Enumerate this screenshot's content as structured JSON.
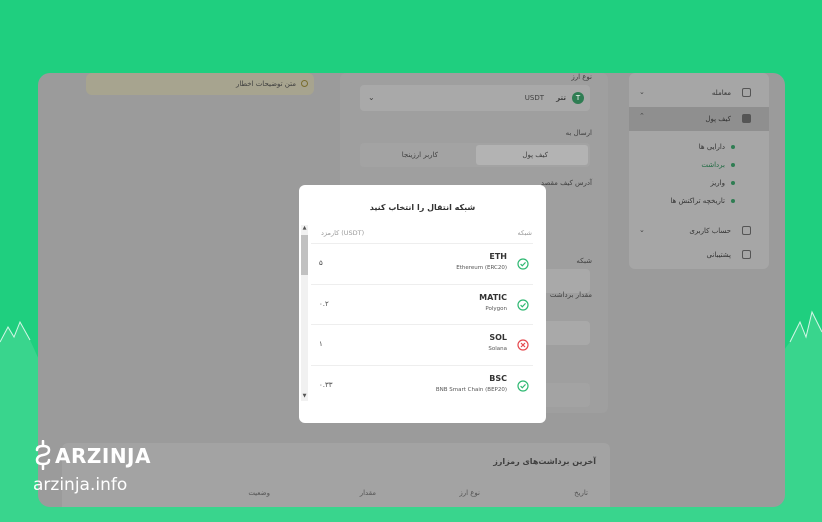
{
  "modal": {
    "title": "شبکه انتقال را انتخاب کنید",
    "col_network": "شبکه",
    "col_fee": "کارمزد (USDT)",
    "networks": [
      {
        "symbol": "ETH",
        "name": "Ethereum (ERC20)",
        "fee": "۵",
        "status": "available",
        "status_color": "#2eb872"
      },
      {
        "symbol": "MATIC",
        "name": "Polygon",
        "fee": "۰.۲",
        "status": "available",
        "status_color": "#2eb872"
      },
      {
        "symbol": "SOL",
        "name": "Solana",
        "fee": "۱",
        "status": "unavailable",
        "status_color": "#e5484d"
      },
      {
        "symbol": "BSC",
        "name": "BNB Smart Chain (BEP20)",
        "fee": "۰.۳۳",
        "status": "available",
        "status_color": "#2eb872"
      }
    ]
  },
  "background": {
    "warning_text": "متن توضیحات اخطار",
    "coin_label": "نوع ارز",
    "coin_name": "تتر",
    "coin_code": "USDT",
    "send_to_label": "ارسال به",
    "send_tab_wallet": "کیف پول",
    "send_tab_cryptaa": "کاربر ارزینجا",
    "dest_address_label": "آدرس کیف مقصد",
    "network_label": "شبکه",
    "amount_label": "مقدار برداشت",
    "recent_withdrawals": "آخرین برداشت‌های رمزارز",
    "table_headers": [
      "تاریخ",
      "نوع ارز",
      "مقدار",
      "وضعیت"
    ]
  },
  "sidebar": {
    "items": [
      {
        "label": "معامله"
      },
      {
        "label": "کیف پول"
      },
      {
        "label": "دارایی ها"
      },
      {
        "label": "برداشت"
      },
      {
        "label": "واریز"
      },
      {
        "label": "تاریخچه تراکنش ها"
      },
      {
        "label": "حساب کاربری"
      },
      {
        "label": "پشتیبانی"
      }
    ]
  },
  "brand": {
    "name": "ARZINJA",
    "url": "arzinja.info",
    "bg_color": "#1fcf7f"
  }
}
